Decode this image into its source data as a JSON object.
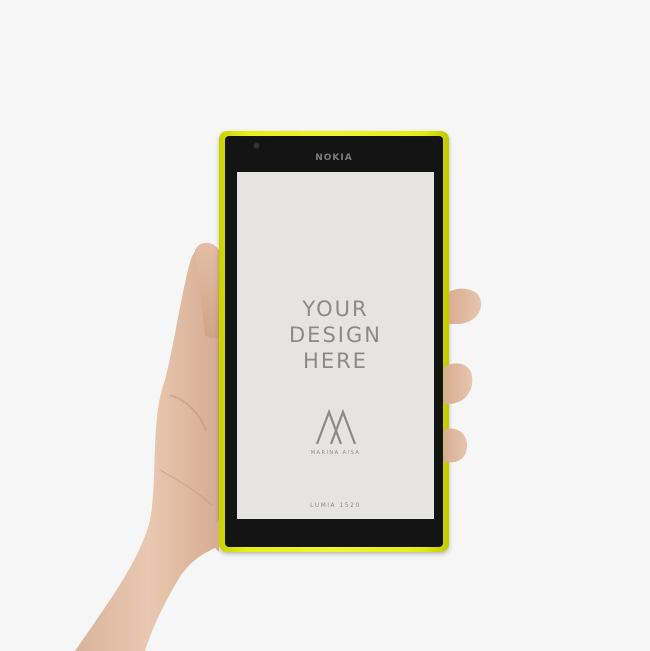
{
  "phone": {
    "brand_label": "NOKIA",
    "screen_headline": [
      "YOUR",
      "DESIGN",
      "HERE"
    ],
    "logo_caption": "MARINA AISA",
    "model_label": "LUMIA 1520",
    "body_color": "#e9f020",
    "screen_color": "#e6e4e1"
  },
  "background_color": "#f6f6f6"
}
